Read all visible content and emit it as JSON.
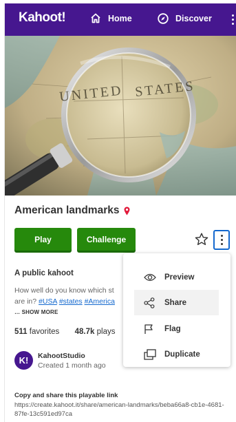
{
  "nav": {
    "logo": "Kahoot!",
    "home_label": "Home",
    "discover_label": "Discover"
  },
  "kahoot": {
    "title": "American landmarks",
    "play_label": "Play",
    "challenge_label": "Challenge",
    "visibility": "A public kahoot",
    "description_line1": "How well do you know which st",
    "description_line2_prefix": "are in? ",
    "tags": [
      "#USA",
      "#states",
      "#America"
    ],
    "show_more": "… SHOW MORE",
    "favorites_count": "511",
    "favorites_label": "favorites",
    "plays_count": "48.7k",
    "plays_label": "plays"
  },
  "creator": {
    "avatar_initials": "K!",
    "name": "KahootStudio",
    "created": "Created 1 month ago"
  },
  "share": {
    "label": "Copy and share this playable link",
    "url": "https://create.kahoot.it/share/american-landmarks/beba66a8-cb1e-4681-87fe-13c591ed97ca"
  },
  "menu": {
    "items": [
      {
        "label": "Preview",
        "icon": "eye-icon"
      },
      {
        "label": "Share",
        "icon": "share-icon"
      },
      {
        "label": "Flag",
        "icon": "flag-icon"
      },
      {
        "label": "Duplicate",
        "icon": "duplicate-icon"
      }
    ]
  },
  "colors": {
    "brand": "#46178f",
    "play_green": "#26890c",
    "accent_blue": "#1368ce",
    "pin_red": "#e21b3c"
  }
}
